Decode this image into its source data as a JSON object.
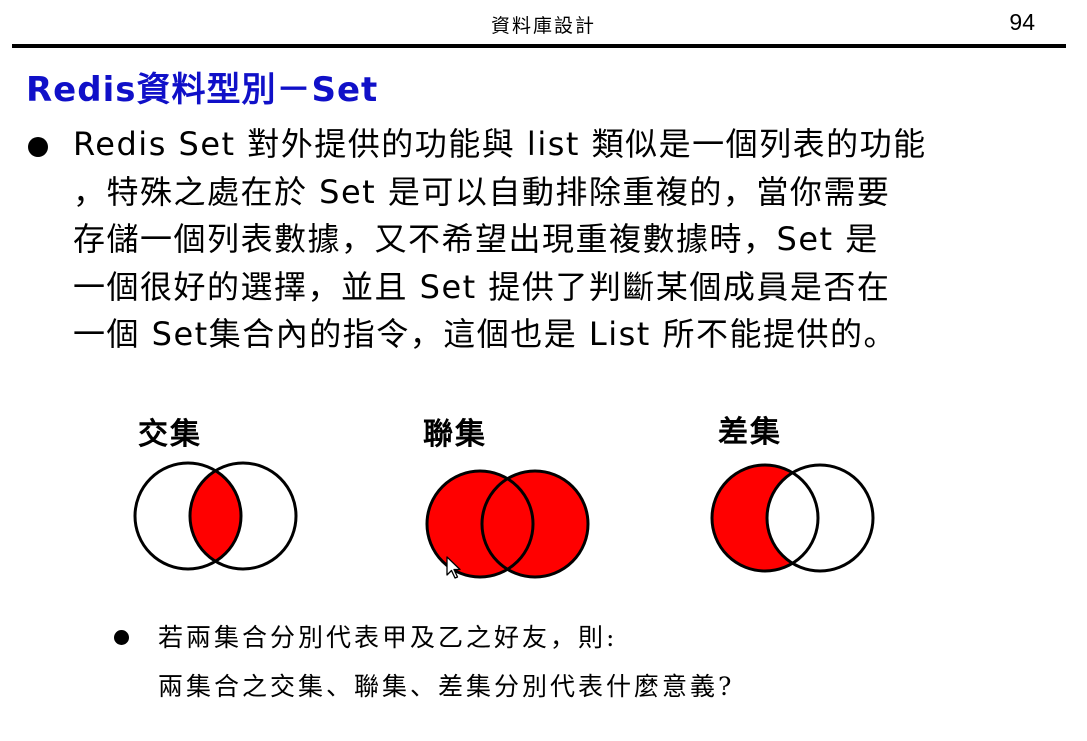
{
  "header": {
    "title": "資料庫設計",
    "page_number": "94"
  },
  "slide": {
    "title": "Redis資料型別－Set",
    "main_bullet": {
      "lines": [
        "Redis Set 對外提供的功能與 list 類似是一個列表的功能",
        "，特殊之處在於 Set 是可以自動排除重複的，當你需要",
        "存儲一個列表數據，又不希望出現重複數據時，Set 是",
        "一個很好的選擇，並且 Set 提供了判斷某個成員是否在",
        "一個 Set集合內的指令，這個也是 List 所不能提供的。"
      ]
    },
    "diagrams": [
      {
        "label": "交集",
        "type": "intersection"
      },
      {
        "label": "聯集",
        "type": "union"
      },
      {
        "label": "差集",
        "type": "difference"
      }
    ],
    "sub_bullet": {
      "lines": [
        "若兩集合分別代表甲及乙之好友，則:",
        "兩集合之交集、聯集、差集分別代表什麼意義?"
      ]
    }
  },
  "colors": {
    "title": "#1010c8",
    "fill": "#ff0000",
    "outline": "#000000"
  }
}
